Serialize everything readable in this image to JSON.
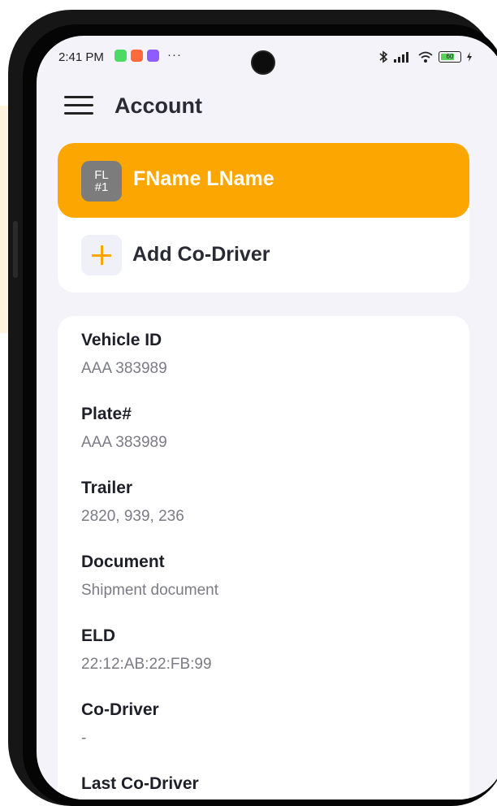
{
  "status": {
    "time": "2:41 PM",
    "more": "···",
    "battery": "60",
    "app_colors": [
      "#4cd964",
      "#ff6a3d",
      "#8e5cff"
    ]
  },
  "header": {
    "title": "Account"
  },
  "drivers": {
    "current": {
      "avatar_line1": "FL",
      "avatar_line2": "#1",
      "name": "FName LName"
    },
    "add_label": "Add Co-Driver"
  },
  "details": [
    {
      "label": "Vehicle ID",
      "value": "AAA 383989"
    },
    {
      "label": "Plate#",
      "value": "AAA 383989"
    },
    {
      "label": "Trailer",
      "value": "2820, 939, 236"
    },
    {
      "label": "Document",
      "value": "Shipment document"
    },
    {
      "label": "ELD",
      "value": "22:12:AB:22:FB:99"
    },
    {
      "label": "Co-Driver",
      "value": "-"
    },
    {
      "label": "Last Co-Driver",
      "value": ""
    }
  ],
  "colors": {
    "accent": "#fca601",
    "background": "#f3f3f9"
  }
}
